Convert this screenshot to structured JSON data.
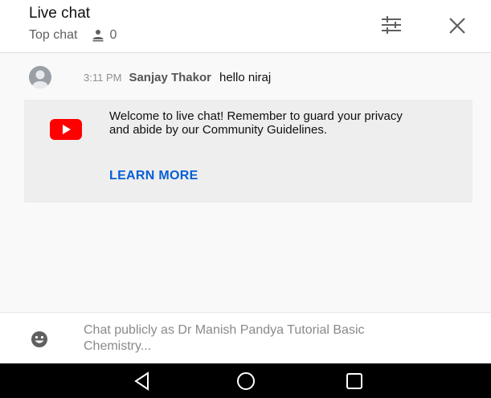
{
  "header": {
    "title": "Live chat",
    "mode_label": "Top chat",
    "viewer_count": "0",
    "icons": [
      "person-icon",
      "filter-settings-icon",
      "close-icon"
    ]
  },
  "chat": {
    "messages": [
      {
        "time": "3:11 PM",
        "author": "Sanjay Thakor",
        "text": "hello niraj",
        "avatar_icon": "default-avatar-icon"
      }
    ]
  },
  "banner": {
    "icon": "youtube-logo-icon",
    "text": "Welcome to live chat! Remember to guard your privacy and abide by our Community Guidelines.",
    "link_label": "LEARN MORE"
  },
  "input": {
    "icon": "emoji-icon",
    "placeholder": "Chat publicly as Dr Manish Pandya Tutorial Basic Chemistry..."
  },
  "navbar": {
    "icons": [
      "back-icon",
      "home-icon",
      "recents-icon"
    ]
  },
  "colors": {
    "link": "#065fd4",
    "youtube_red": "#ff0000",
    "background": "#f9f9f9",
    "banner_bg": "#eeeeee"
  }
}
